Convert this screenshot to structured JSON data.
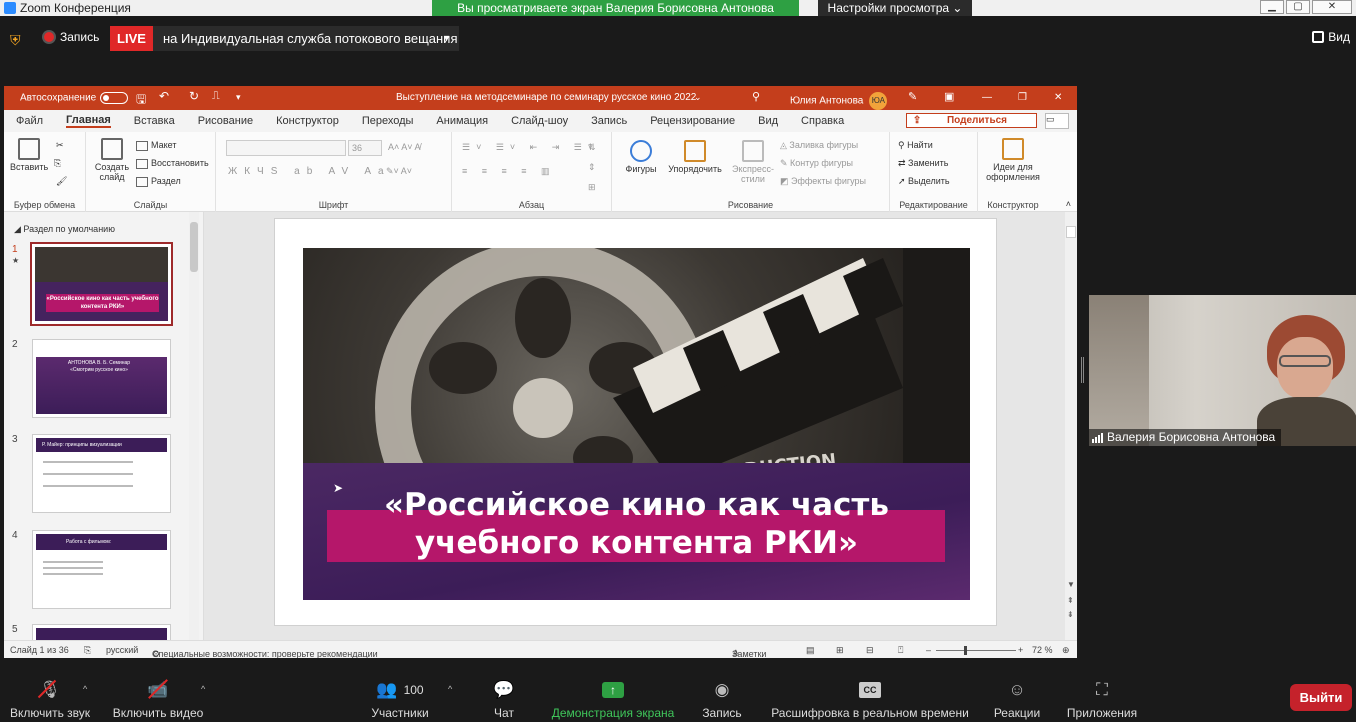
{
  "window": {
    "app_title": "Zoom Конференция",
    "share_banner": "Вы просматриваете экран Валерия Борисовна Антонова",
    "view_options": "Настройки просмотра",
    "minimize": "▁",
    "maximize": "▢",
    "close": "✕"
  },
  "meeting_top": {
    "record_label": "Запись",
    "live_badge": "LIVE",
    "stream_label": "на Индивидуальная служба потокового вещания",
    "view_label": "Вид"
  },
  "powerpoint": {
    "autosave_label": "Автосохранение",
    "doc_title": "Выступление на методсеминаре по семинару русское кино 2022",
    "user_name": "Юлия Антонова",
    "user_initials": "ЮА",
    "menu": [
      "Файл",
      "Главная",
      "Вставка",
      "Рисование",
      "Конструктор",
      "Переходы",
      "Анимация",
      "Слайд-шоу",
      "Запись",
      "Рецензирование",
      "Вид",
      "Справка"
    ],
    "share_button": "Поделиться",
    "ribbon": {
      "paste": "Вставить",
      "clipboard_group": "Буфер обмена",
      "new_slide": "Создать слайд",
      "layout": "Макет",
      "reset": "Восстановить",
      "section": "Раздел",
      "slides_group": "Слайды",
      "font_size": "36",
      "font_group": "Шрифт",
      "paragraph_group": "Абзац",
      "shapes": "Фигуры",
      "arrange": "Упорядочить",
      "quick_styles": "Экспресс-стили",
      "shape_fill": "Заливка фигуры",
      "shape_outline": "Контур фигуры",
      "shape_effects": "Эффекты фигуры",
      "drawing_group": "Рисование",
      "find": "Найти",
      "replace": "Заменить",
      "select": "Выделить",
      "editing_group": "Редактирование",
      "design_ideas": "Идеи для оформления",
      "designer_group": "Конструктор"
    },
    "section_name": "Раздел по умолчанию",
    "thumbnails": [
      {
        "num": "1",
        "text": "«Российское кино как часть учебного контента РКИ»"
      },
      {
        "num": "2",
        "text": "АНТОНОВА В. Б. Семинар «Смотрим русское кино»"
      },
      {
        "num": "3",
        "text": "Р. Майер: принципы визуализации"
      },
      {
        "num": "4",
        "text": "Работа с фильмом:"
      },
      {
        "num": "5",
        "text": ""
      }
    ],
    "slide_title": "«Российское кино как часть учебного контента РКИ»",
    "status": {
      "slide_counter": "Слайд 1 из 36",
      "language": "русский",
      "accessibility": "Специальные возможности: проверьте рекомендации",
      "notes": "Заметки",
      "zoom": "72 %"
    },
    "colors": {
      "accent": "#c43e1c",
      "slide_band": "#b5176a",
      "slide_purple": "#3c1d58"
    }
  },
  "participant": {
    "name": "Валерия Борисовна Антонова"
  },
  "toolbar": {
    "unmute": "Включить звук",
    "start_video": "Включить видео",
    "participants": "Участники",
    "participants_count": "100",
    "chat": "Чат",
    "share_screen": "Демонстрация экрана",
    "record": "Запись",
    "captions": "Расшифровка в реальном времени",
    "captions_icon_text": "CC",
    "reactions": "Реакции",
    "apps": "Приложения",
    "leave": "Выйти"
  }
}
